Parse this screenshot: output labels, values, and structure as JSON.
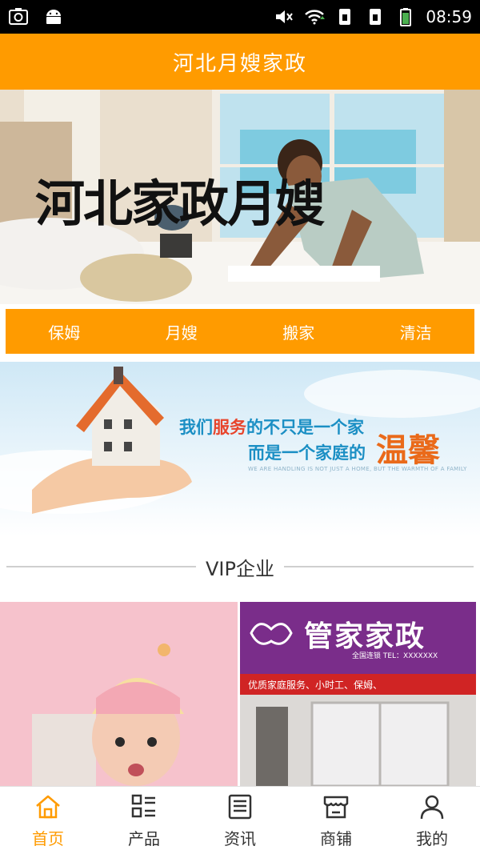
{
  "status_bar": {
    "time": "08:59",
    "icons": [
      "screenshot-icon",
      "android-icon",
      "mute-icon",
      "wifi-icon",
      "sim1-icon",
      "sim2-icon",
      "battery-icon"
    ]
  },
  "header": {
    "title": "河北月嫂家政"
  },
  "banner": {
    "text": "河北家政月嫂"
  },
  "categories": [
    {
      "label": "保姆"
    },
    {
      "label": "月嫂"
    },
    {
      "label": "搬家"
    },
    {
      "label": "清洁"
    }
  ],
  "promo": {
    "line1_prefix": "我们",
    "line1_accent": "服务",
    "line1_suffix": "的不只是一个家",
    "line2": "而是一个家庭的",
    "warm": "温馨",
    "subtitle": "WE ARE HANDLING IS NOT JUST A HOME, BUT THE WARMTH OF A FAMILY"
  },
  "section": {
    "title": "VIP企业"
  },
  "vip": {
    "card2_sign": "管家家政",
    "card2_sign_sub": "全国连锁  TEL：XXXXXXX",
    "card2_strip": "优质家庭服务、小时工、保姆、"
  },
  "tabs": [
    {
      "label": "首页",
      "icon": "home-icon",
      "active": true
    },
    {
      "label": "产品",
      "icon": "grid-list-icon",
      "active": false
    },
    {
      "label": "资讯",
      "icon": "news-icon",
      "active": false
    },
    {
      "label": "商铺",
      "icon": "store-icon",
      "active": false
    },
    {
      "label": "我的",
      "icon": "user-icon",
      "active": false
    }
  ],
  "colors": {
    "accent": "#ff9b00",
    "status_bar": "#000000",
    "active_tab": "#ff9b00"
  }
}
